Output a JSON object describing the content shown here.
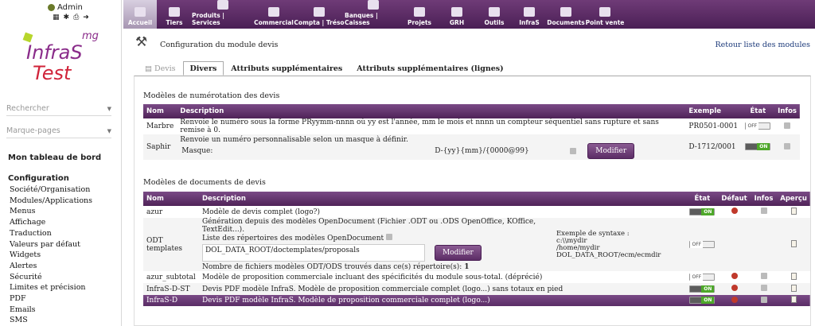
{
  "user": {
    "name": "Admin"
  },
  "logo": {
    "mg": "mg",
    "line1": "InfraS",
    "line2": "Test"
  },
  "sidebar": {
    "search_placeholder": "Rechercher",
    "bookmarks_placeholder": "Marque-pages",
    "dashboard": "Mon tableau de bord",
    "config_title": "Configuration",
    "config_items": [
      "Société/Organisation",
      "Modules/Applications",
      "Menus",
      "Affichage",
      "Traduction",
      "Valeurs par défaut",
      "Widgets",
      "Alertes",
      "Sécurité",
      "Limites et précision",
      "PDF",
      "Emails",
      "SMS"
    ]
  },
  "topmenu": [
    {
      "label": "Accueil",
      "active": true
    },
    {
      "label": "Tiers"
    },
    {
      "label": "Produits | Services"
    },
    {
      "label": "Commercial"
    },
    {
      "label": "Compta | Tréso"
    },
    {
      "label": "Banques | Caisses"
    },
    {
      "label": "Projets"
    },
    {
      "label": "GRH"
    },
    {
      "label": "Outils"
    },
    {
      "label": "InfraS"
    },
    {
      "label": "Documents"
    },
    {
      "label": "Point vente"
    }
  ],
  "page": {
    "title": "Configuration du module devis",
    "back_link": "Retour liste des modules",
    "tabs": [
      "Devis",
      "Divers",
      "Attributs supplémentaires",
      "Attributs supplémentaires (lignes)"
    ]
  },
  "numbering": {
    "section_title": "Modèles de numérotation des devis",
    "headers": [
      "Nom",
      "Description",
      "Exemple",
      "État",
      "Infos"
    ],
    "rows": [
      {
        "name": "Marbre",
        "description": "Renvoie le numéro sous la forme PRyymm-nnnn où yy est l'année, mm le mois et nnnn un compteur séquentiel sans rupture et sans remise à 0.",
        "example": "PR0501-0001",
        "state": "off"
      },
      {
        "name": "Saphir",
        "description": "Renvoie un numéro personnalisable selon un masque à définir.",
        "mask_label": "Masque:",
        "mask_value": "D-{yy}{mm}/{0000@99}",
        "button": "Modifier",
        "example": "D-1712/0001",
        "state": "on"
      }
    ]
  },
  "documents": {
    "section_title": "Modèles de documents de devis",
    "headers": [
      "Nom",
      "Description",
      "État",
      "Défaut",
      "Infos",
      "Aperçu"
    ],
    "rows": [
      {
        "name": "azur",
        "description": "Modèle de devis complet (logo?)",
        "state": "on"
      },
      {
        "name": "ODT templates",
        "line1": "Génération depuis des modèles OpenDocument (Fichier .ODT ou .ODS OpenOffice, KOffice, TextEdit...).",
        "line2": "Liste des répertoires des modèles OpenDocument",
        "dir_value": "DOL_DATA_ROOT/doctemplates/proposals",
        "button": "Modifier",
        "count_label": "Nombre de fichiers modèles ODT/ODS trouvés dans ce(s) répertoire(s):",
        "count": "1",
        "syntax_title": "Exemple de syntaxe :",
        "syntax_lines": [
          "c:\\\\mydir",
          "/home/mydir",
          "DOL_DATA_ROOT/ecm/ecmdir"
        ],
        "state": "off"
      },
      {
        "name": "azur_subtotal",
        "description": "Modèle de proposition commerciale incluant des spécificités du module sous-total. (déprécié)",
        "state": "off"
      },
      {
        "name": "InfraS-D-ST",
        "description": "Devis PDF modèle InfraS. Modèle de proposition commerciale complet (logo...) sans totaux en pied",
        "state": "on"
      },
      {
        "name": "InfraS-D",
        "description": "Devis PDF modèle InfraS. Modèle de proposition commerciale complet (logo...)",
        "state": "on"
      }
    ]
  }
}
